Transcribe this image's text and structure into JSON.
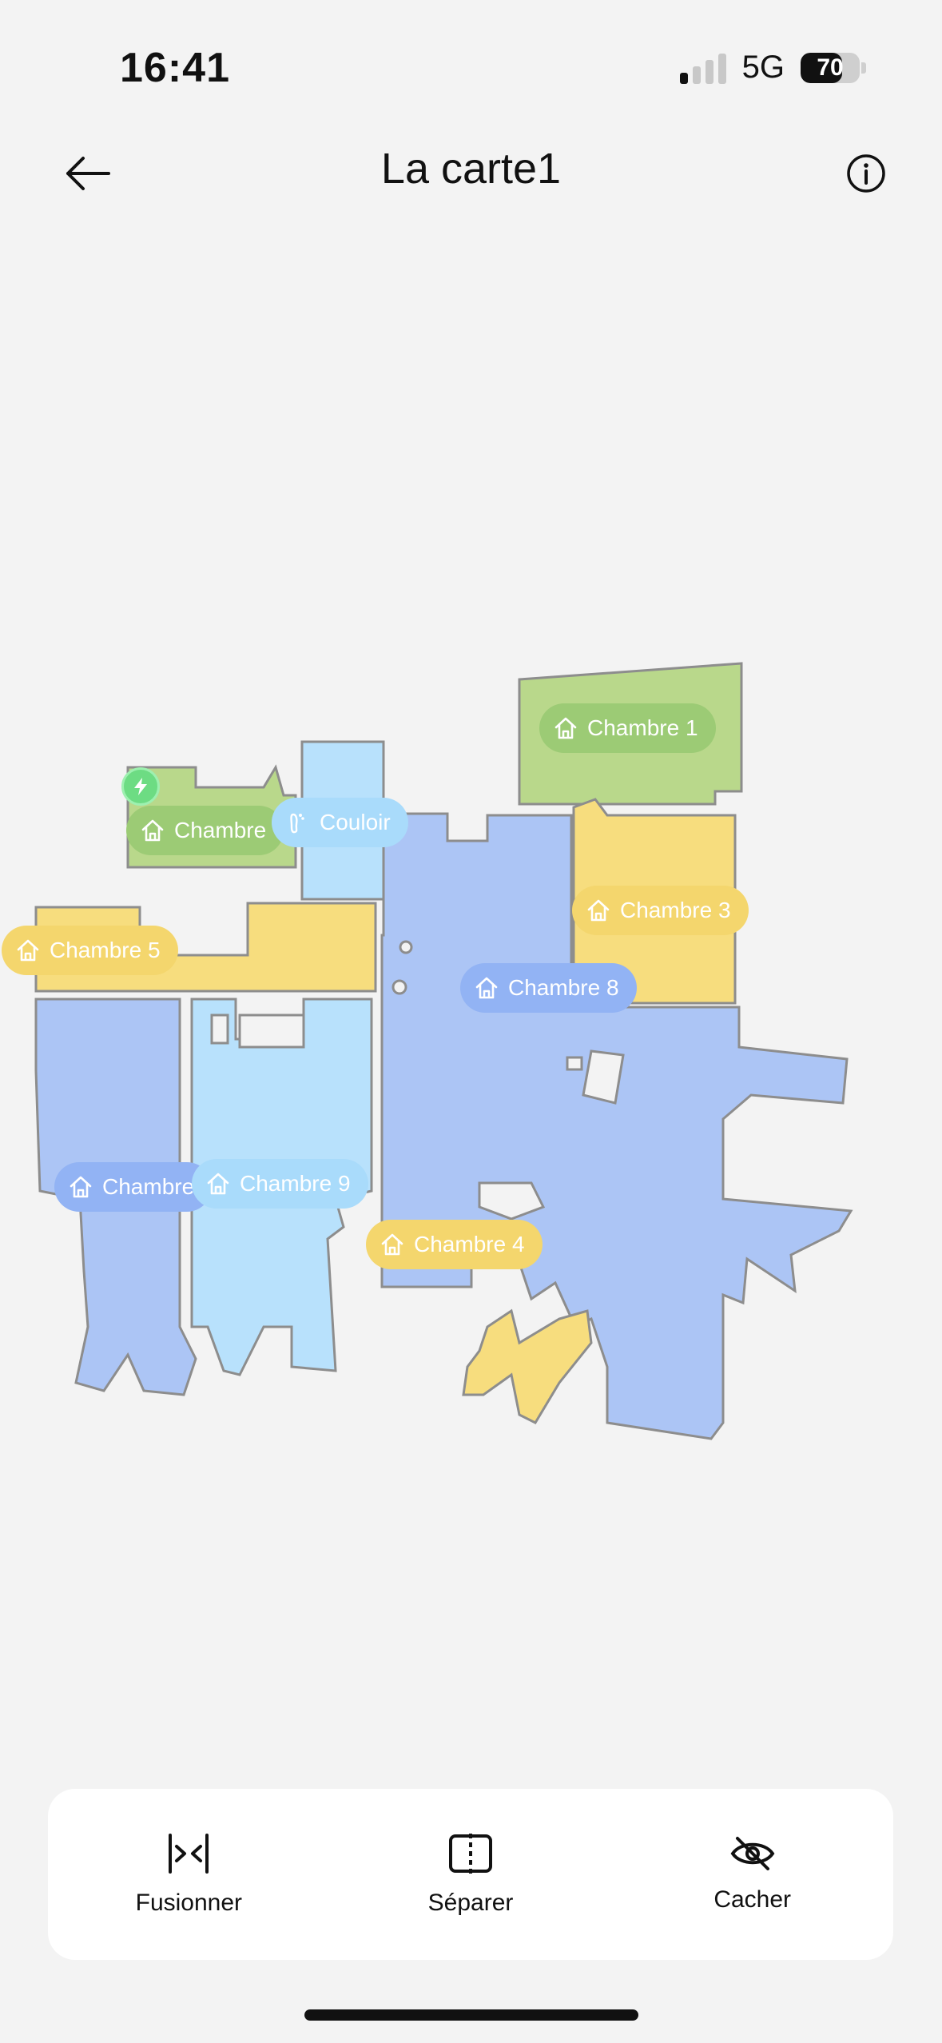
{
  "status": {
    "time": "16:41",
    "network": "5G",
    "battery": "70",
    "battery_level": 0.7,
    "signal_bars_active": 1
  },
  "header": {
    "title": "La carte1",
    "back_icon": "arrow-left-icon",
    "info_icon": "info-circle-icon"
  },
  "map": {
    "colors": {
      "green": "#b9d88b",
      "yellow": "#f7dd7e",
      "blue": "#acc5f5",
      "lightblue": "#b8e1fc",
      "border": "#8d8d8d"
    },
    "rooms": [
      {
        "label": "Chambre 1",
        "icon": "house-icon",
        "color": "green"
      },
      {
        "label": "Chambre",
        "icon": "house-icon",
        "color": "green"
      },
      {
        "label": "Couloir",
        "icon": "footprint-icon",
        "color": "lightblue"
      },
      {
        "label": "Chambre 3",
        "icon": "house-icon",
        "color": "yellow"
      },
      {
        "label": "Chambre 5",
        "icon": "house-icon",
        "color": "yellow"
      },
      {
        "label": "Chambre 8",
        "icon": "house-icon",
        "color": "blue"
      },
      {
        "label": "Chambre",
        "icon": "house-icon",
        "color": "blue"
      },
      {
        "label": "Chambre 9",
        "icon": "house-icon",
        "color": "lightblue"
      },
      {
        "label": "Chambre 4",
        "icon": "house-icon",
        "color": "yellow"
      }
    ],
    "dock_icon": "charging-dock-icon"
  },
  "actions": [
    {
      "label": "Fusionner",
      "icon": "merge-icon"
    },
    {
      "label": "Séparer",
      "icon": "split-icon"
    },
    {
      "label": "Cacher",
      "icon": "eye-off-icon"
    }
  ]
}
